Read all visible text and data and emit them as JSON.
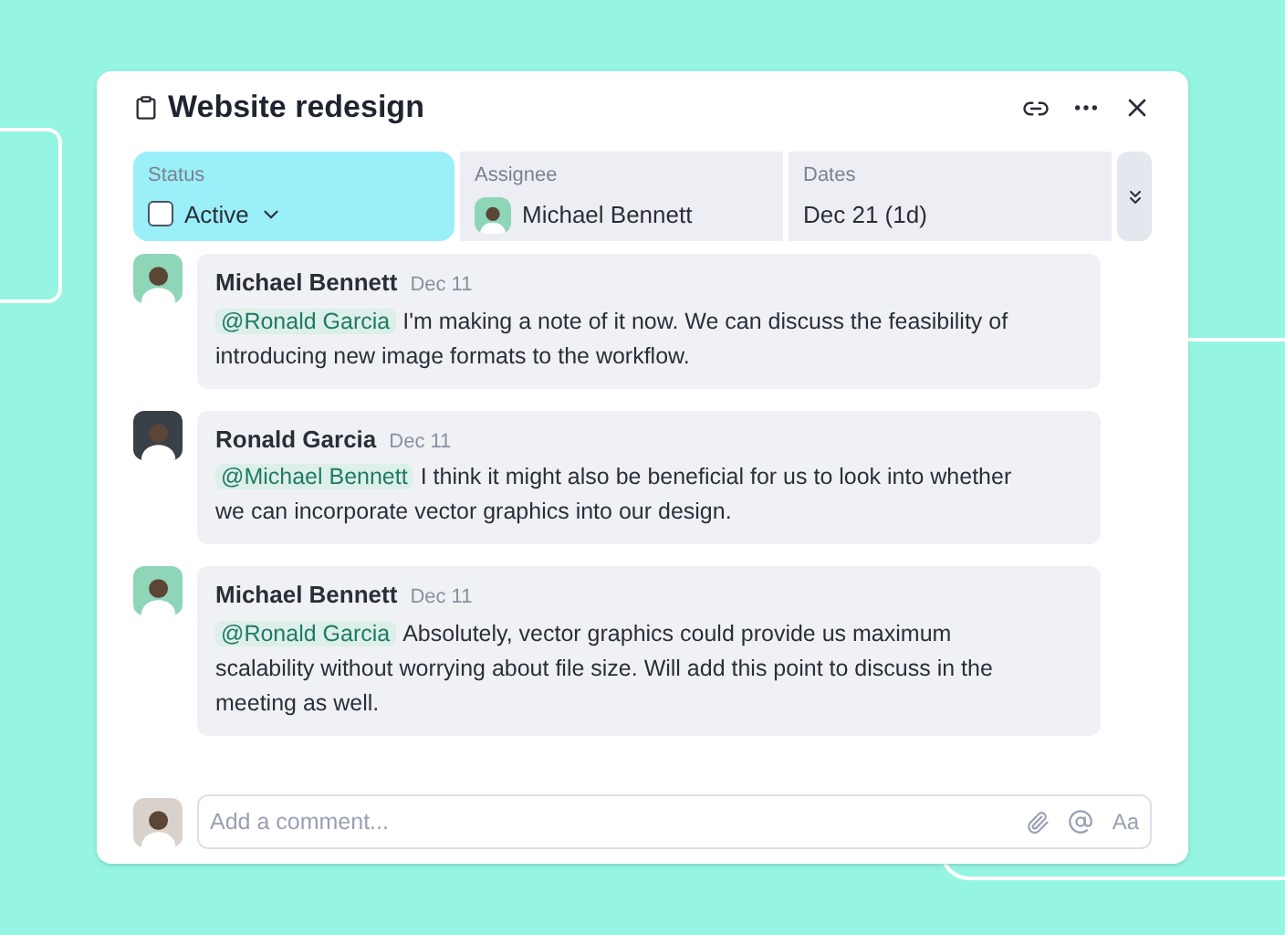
{
  "task": {
    "title": "Website redesign"
  },
  "fields": [
    {
      "kind": "status",
      "label": "Status",
      "value": "Active",
      "checked": false,
      "selected": true
    },
    {
      "kind": "assignee",
      "label": "Assignee",
      "value": "Michael Bennett",
      "selected": false
    },
    {
      "kind": "dates",
      "label": "Dates",
      "value": "Dec 21 (1d)",
      "selected": false
    }
  ],
  "comments": [
    {
      "author": "Michael Bennett",
      "date": "Dec 11",
      "mention": "@Ronald Garcia",
      "text": "I'm making a note of it now. We can discuss the feasibility of introducing new image formats to the workflow.",
      "color": "#8fd6b8"
    },
    {
      "author": "Ronald Garcia",
      "date": "Dec 11",
      "mention": "@Michael Bennett",
      "text": "I think it might also be beneficial for us to look into whether we can incorporate vector graphics into our design.",
      "color": "#3a4048"
    },
    {
      "author": "Michael Bennett",
      "date": "Dec 11",
      "mention": "@Ronald Garcia",
      "text": "Absolutely, vector graphics could provide us maximum scalability without worrying about file size. Will add this point to discuss in the meeting as well.",
      "color": "#8fd6b8"
    }
  ],
  "composer": {
    "placeholder": "Add a comment...",
    "format_label": "Aa"
  }
}
